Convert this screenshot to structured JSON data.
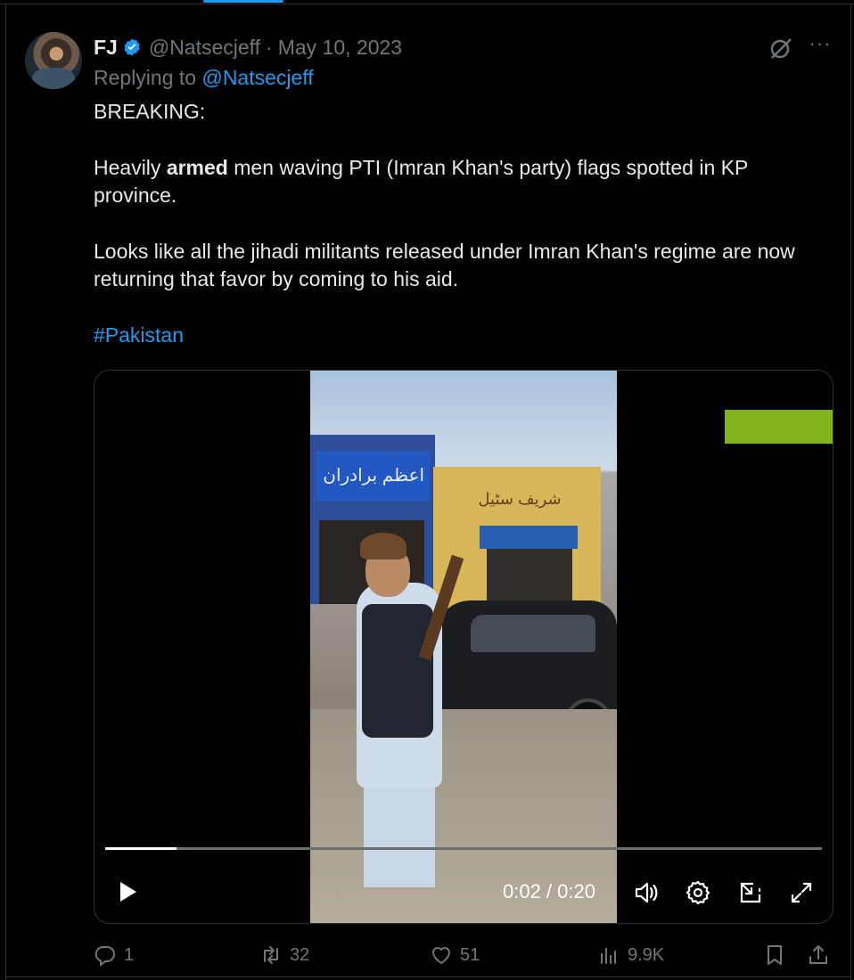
{
  "tweet": {
    "name": "FJ",
    "handle": "@Natsecjeff",
    "separator": "·",
    "date": "May 10, 2023",
    "replying_prefix": "Replying to ",
    "replying_handle": "@Natsecjeff",
    "line1": "BREAKING:",
    "line2_pre": "Heavily ",
    "line2_bold": "armed",
    "line2_post": " men waving PTI (Imran Khan's party) flags spotted in KP province.",
    "line3": "Looks like all the jihadi militants released under Imran Khan's regime are now returning that favor by coming to his aid.",
    "hashtag": "#Pakistan",
    "more_label": "···"
  },
  "video": {
    "time_display": "0:02 / 0:20",
    "progress_fraction": 0.1,
    "sign_left": "اعظم برادران",
    "sign_right": "شریف سٹیل"
  },
  "actions": {
    "replies": "1",
    "reposts": "32",
    "likes": "51",
    "views": "9.9K"
  },
  "colors": {
    "background": "#000000",
    "text": "#e7e9ea",
    "muted": "#71767b",
    "accent": "#1d9bf0",
    "overlay_green": "#7fb51a"
  },
  "icons": [
    "verified-badge-icon",
    "grok-icon",
    "more-icon",
    "play-icon",
    "volume-icon",
    "settings-icon",
    "pip-icon",
    "fullscreen-icon",
    "reply-icon",
    "repost-icon",
    "like-icon",
    "views-icon",
    "bookmark-icon",
    "share-icon"
  ]
}
